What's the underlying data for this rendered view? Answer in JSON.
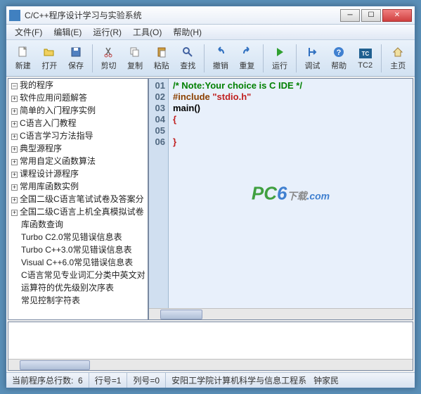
{
  "window": {
    "title": "C/C++程序设计学习与实验系统"
  },
  "menu": {
    "file": "文件(F)",
    "edit": "编辑(E)",
    "run": "运行(R)",
    "tools": "工具(O)",
    "help": "帮助(H)"
  },
  "toolbar": {
    "new": "新建",
    "open": "打开",
    "save": "保存",
    "cut": "剪切",
    "copy": "复制",
    "paste": "粘贴",
    "find": "查找",
    "undo": "撤销",
    "redo": "重复",
    "run": "运行",
    "debug": "调试",
    "helpBtn": "帮助",
    "tc2": "TC2",
    "home": "主页"
  },
  "tree": {
    "items": [
      {
        "label": "我的程序",
        "expandable": true,
        "expanded": true
      },
      {
        "label": "软件应用问题解答",
        "expandable": true
      },
      {
        "label": "简单的入门程序实例",
        "expandable": true
      },
      {
        "label": "C语言入门教程",
        "expandable": true
      },
      {
        "label": "C语言学习方法指导",
        "expandable": true
      },
      {
        "label": "典型源程序",
        "expandable": true
      },
      {
        "label": "常用自定义函数算法",
        "expandable": true
      },
      {
        "label": "课程设计源程序",
        "expandable": true
      },
      {
        "label": "常用库函数实例",
        "expandable": true
      },
      {
        "label": "全国二级C语言笔试试卷及答案分",
        "expandable": true
      },
      {
        "label": "全国二级C语言上机全真模拟试卷",
        "expandable": true
      },
      {
        "label": "库函数查询",
        "expandable": false
      },
      {
        "label": "Turbo C2.0常见错误信息表",
        "expandable": false
      },
      {
        "label": "Turbo C++3.0常见错误信息表",
        "expandable": false
      },
      {
        "label": "Visual C++6.0常见错误信息表",
        "expandable": false
      },
      {
        "label": "C语言常见专业词汇分类中英文对",
        "expandable": false
      },
      {
        "label": "运算符的优先级别次序表",
        "expandable": false
      },
      {
        "label": "常见控制字符表",
        "expandable": false
      }
    ]
  },
  "code": {
    "lines": [
      "01",
      "02",
      "03",
      "04",
      "05",
      "06"
    ],
    "l1_comment": "/* Note:Your choice is C IDE */",
    "l2_pre": "#include ",
    "l2_str": "\"stdio.h\"",
    "l3": "main()",
    "l4": "{",
    "l5": "",
    "l6": "}"
  },
  "watermark": {
    "brand1": "PC",
    "brand2": "6",
    "suffix": "下载",
    "domain": ".com"
  },
  "status": {
    "lineCountLabel": "当前程序总行数:",
    "lineCount": "6",
    "rowLabel": "行号=1",
    "colLabel": "列号=0",
    "org": "安阳工学院计算机科学与信息工程系",
    "author": "钟家民"
  }
}
